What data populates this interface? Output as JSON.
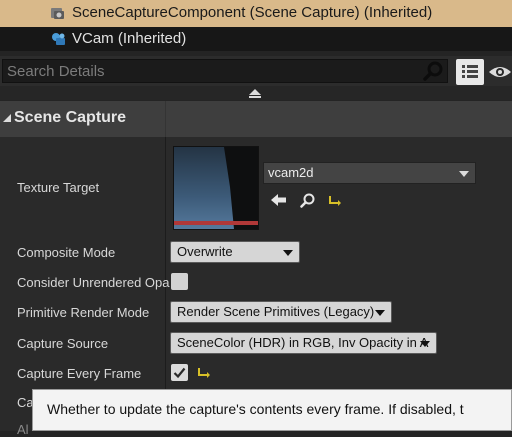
{
  "components": [
    {
      "label": "SceneCaptureComponent (Scene Capture) (Inherited)",
      "icon": "scene-capture-icon",
      "selected": true
    },
    {
      "label": "VCam (Inherited)",
      "icon": "vcam-icon",
      "selected": false
    }
  ],
  "search": {
    "placeholder": "Search Details",
    "value": ""
  },
  "category": {
    "title": "Scene Capture"
  },
  "properties": {
    "texture_target": {
      "label": "Texture Target",
      "asset": "vcam2d"
    },
    "composite_mode": {
      "label": "Composite Mode",
      "value": "Overwrite"
    },
    "consider_unrendered": {
      "label": "Consider Unrendered Opa",
      "checked": false
    },
    "primitive_render_mode": {
      "label": "Primitive Render Mode",
      "value": "Render Scene Primitives (Legacy)"
    },
    "capture_source": {
      "label": "Capture Source",
      "value": "SceneColor (HDR) in RGB, Inv Opacity in A"
    },
    "capture_every_frame": {
      "label": "Capture Every Frame",
      "checked": true
    },
    "partial_row_1": {
      "label": "Ca"
    },
    "partial_row_2": {
      "label": "Al"
    }
  },
  "tooltip": {
    "text": "Whether to update the capture's contents every frame.  If disabled, t"
  },
  "colors": {
    "selected_row": "#d9b98a",
    "panel_bg": "#242424",
    "dropdown_bg": "#d6d6d6",
    "reset_arrow": "#d8c028"
  }
}
